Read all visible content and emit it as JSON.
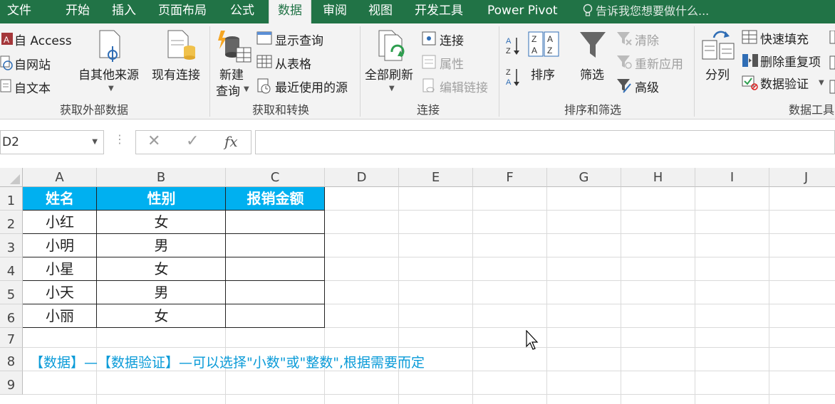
{
  "tabs": [
    "文件",
    "开始",
    "插入",
    "页面布局",
    "公式",
    "数据",
    "审阅",
    "视图",
    "开发工具",
    "Power Pivot"
  ],
  "active_tab": "数据",
  "tell_me": "告诉我您想要做什么...",
  "ribbon": {
    "get_external": {
      "label": "获取外部数据",
      "access": "自 Access",
      "web": "自网站",
      "text": "自文本",
      "other": "自其他来源",
      "existing": "现有连接"
    },
    "transform": {
      "label": "获取和转换",
      "new_query_1": "新建",
      "new_query_2": "查询",
      "show_queries": "显示查询",
      "from_table": "从表格",
      "recent": "最近使用的源"
    },
    "connections": {
      "label": "连接",
      "refresh_all": "全部刷新",
      "connections": "连接",
      "properties": "属性",
      "edit_links": "编辑链接"
    },
    "sort_filter": {
      "label": "排序和筛选",
      "sort": "排序",
      "filter": "筛选",
      "clear": "清除",
      "reapply": "重新应用",
      "advanced": "高级"
    },
    "data_tools": {
      "label": "数据工具",
      "text_to_columns": "分列",
      "flash_fill": "快速填充",
      "remove_dup": "删除重复项",
      "validation": "数据验证"
    }
  },
  "formula_bar": {
    "name_box": "D2",
    "x": "✕",
    "check": "✓",
    "fx": "fx",
    "content": ""
  },
  "columns": [
    "A",
    "B",
    "C",
    "D",
    "E",
    "F",
    "G",
    "H",
    "I",
    "J"
  ],
  "rows": [
    "1",
    "2",
    "3",
    "4",
    "5",
    "6",
    "7",
    "8",
    "9"
  ],
  "table": {
    "headers": [
      "姓名",
      "性别",
      "报销金额"
    ],
    "rows": [
      [
        "小红",
        "女",
        ""
      ],
      [
        "小明",
        "男",
        ""
      ],
      [
        "小星",
        "女",
        ""
      ],
      [
        "小天",
        "男",
        ""
      ],
      [
        "小丽",
        "女",
        ""
      ]
    ]
  },
  "note": "【数据】—【数据验证】—可以选择\"小数\"或\"整数\",根据需要而定",
  "colors": {
    "tabbar": "#217346",
    "header_fill": "#00b0f0",
    "note_text": "#0a9bd8"
  }
}
